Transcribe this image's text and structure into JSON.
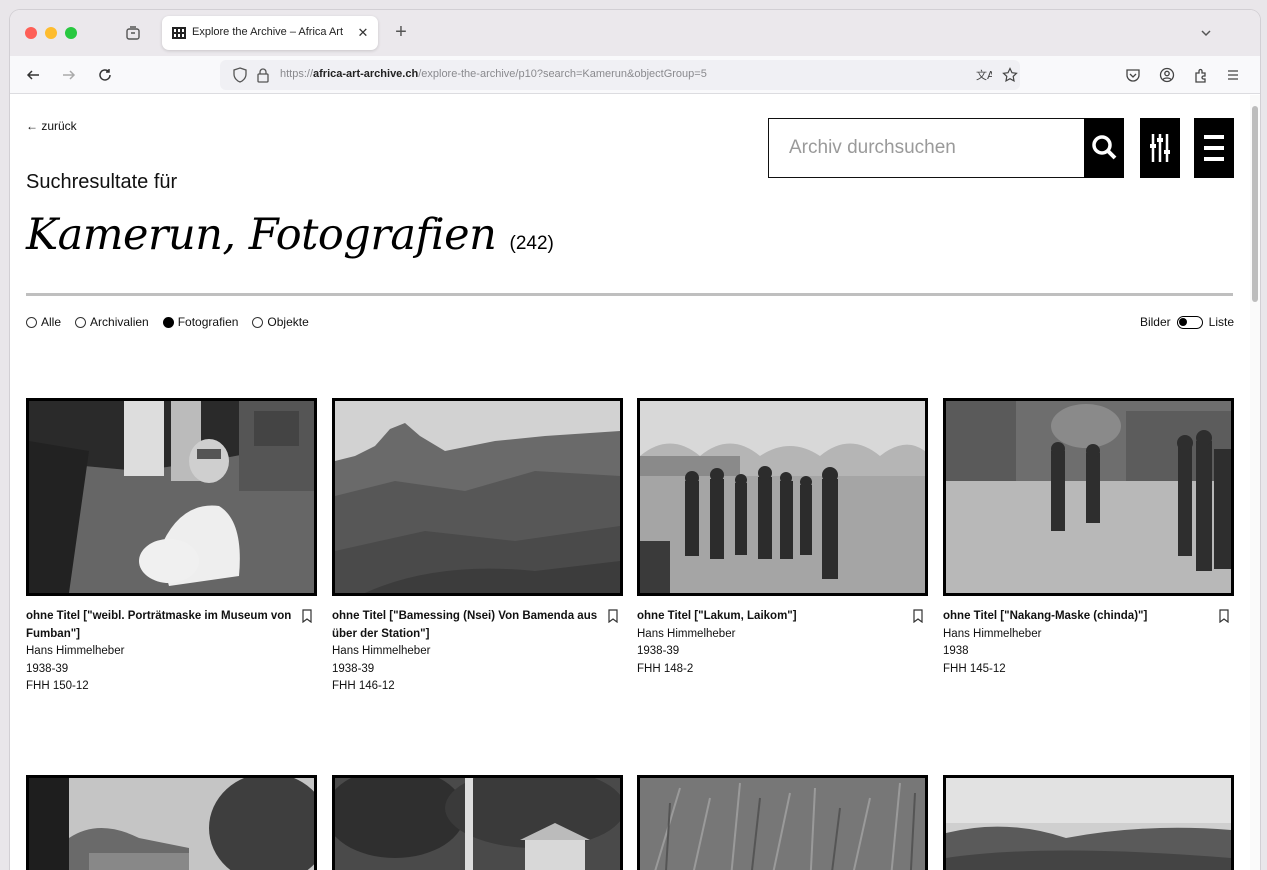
{
  "browser": {
    "tab_title": "Explore the Archive – Africa Art",
    "tab_close": "✕",
    "new_tab": "+",
    "url_prefix": "https://",
    "url_domain": "africa-art-archive.ch",
    "url_path": "/explore-the-archive/p10?search=Kamerun&objectGroup=5"
  },
  "header": {
    "back_label": "← zurück",
    "search_placeholder": "Archiv durchsuchen"
  },
  "results": {
    "subtitle": "Suchresultate für",
    "title": "Kamerun, Fotografien",
    "count": "(242)"
  },
  "filters": [
    {
      "label": "Alle",
      "selected": false
    },
    {
      "label": "Archivalien",
      "selected": false
    },
    {
      "label": "Fotografien",
      "selected": true
    },
    {
      "label": "Objekte",
      "selected": false
    }
  ],
  "view_toggle": {
    "left_label": "Bilder",
    "right_label": "Liste"
  },
  "cards": [
    {
      "title": "ohne Titel [\"weibl. Porträtmaske im Museum von Fumban\"]",
      "author": "Hans Himmelheber",
      "date": "1938-39",
      "id": "FHH 150-12"
    },
    {
      "title": "ohne Titel [\"Bamessing (Nsei) Von Bamenda aus über der Station\"]",
      "author": "Hans Himmelheber",
      "date": "1938-39",
      "id": "FHH 146-12"
    },
    {
      "title": "ohne Titel [\"Lakum, Laikom\"]",
      "author": "Hans Himmelheber",
      "date": "1938-39",
      "id": "FHH 148-2"
    },
    {
      "title": "ohne Titel [\"Nakang-Maske (chinda)\"]",
      "author": "Hans Himmelheber",
      "date": "1938",
      "id": "FHH 145-12"
    }
  ]
}
